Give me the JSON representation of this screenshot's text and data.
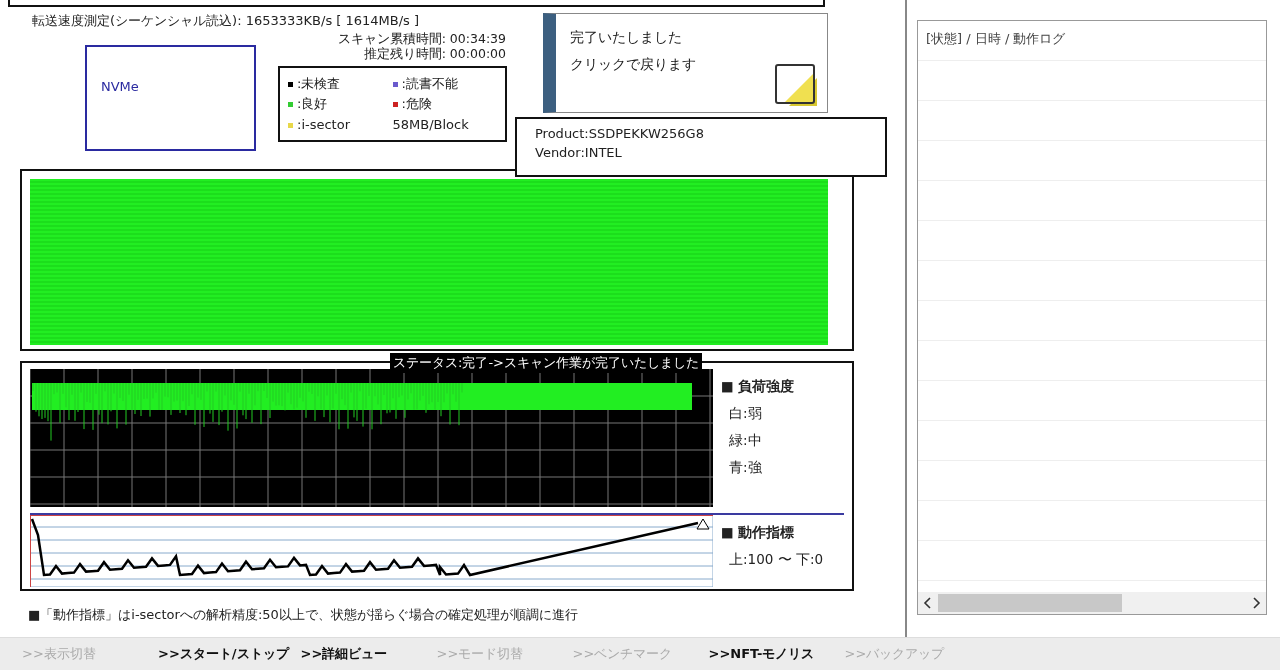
{
  "speed": "転送速度測定(シーケンシャル読込): 1653333KB/s [ 1614MB/s ]",
  "device_type": "NVMe",
  "times": [
    {
      "label": "スキャン累積時間:",
      "value": "00:34:39"
    },
    {
      "label": "推定残り時間:",
      "value": "00:00:00"
    }
  ],
  "legend": {
    "items": [
      {
        "label": ":未検査",
        "color": "#000000"
      },
      {
        "label": ":読書不能",
        "color": "#6a5acd"
      },
      {
        "label": ":良好",
        "color": "#33cc33"
      },
      {
        "label": ":危険",
        "color": "#cc2222"
      },
      {
        "label": ":i-sector",
        "color": "#e8d84a"
      }
    ],
    "block_size": "58MB/Block"
  },
  "notification": {
    "lines": [
      "完了いたしました",
      "クリックで戻ります"
    ]
  },
  "device_info": [
    "Product:SSDPEKKW256G8",
    "Vendor:INTEL"
  ],
  "status": "ステータス:完了->スキャン作業が完了いたしました",
  "load_chart": {
    "legend_title": "■ 負荷強度",
    "legend": [
      "白:弱",
      "緑:中",
      "青:強"
    ]
  },
  "activity_chart": {
    "legend_title": "■ 動作指標",
    "range": "上:100 〜 下:0"
  },
  "footnote": "■「動作指標」はi-sectorへの解析精度:50以上で、状態が揺らぐ場合の確定処理が順調に進行",
  "toolbar": [
    {
      "label": ">>表示切替",
      "disabled": true
    },
    {
      "label": ">>スタート/ストップ",
      "disabled": false
    },
    {
      "label": ">>詳細ビュー",
      "disabled": false
    },
    {
      "label": ">>モード切替",
      "disabled": true
    },
    {
      "label": ">>ベンチマーク",
      "disabled": true
    },
    {
      "label": ">>NFT-モノリス",
      "disabled": false
    },
    {
      "label": ">>バックアップ",
      "disabled": true
    }
  ],
  "log": {
    "header": "[状態] / 日時 / 動作ログ"
  }
}
